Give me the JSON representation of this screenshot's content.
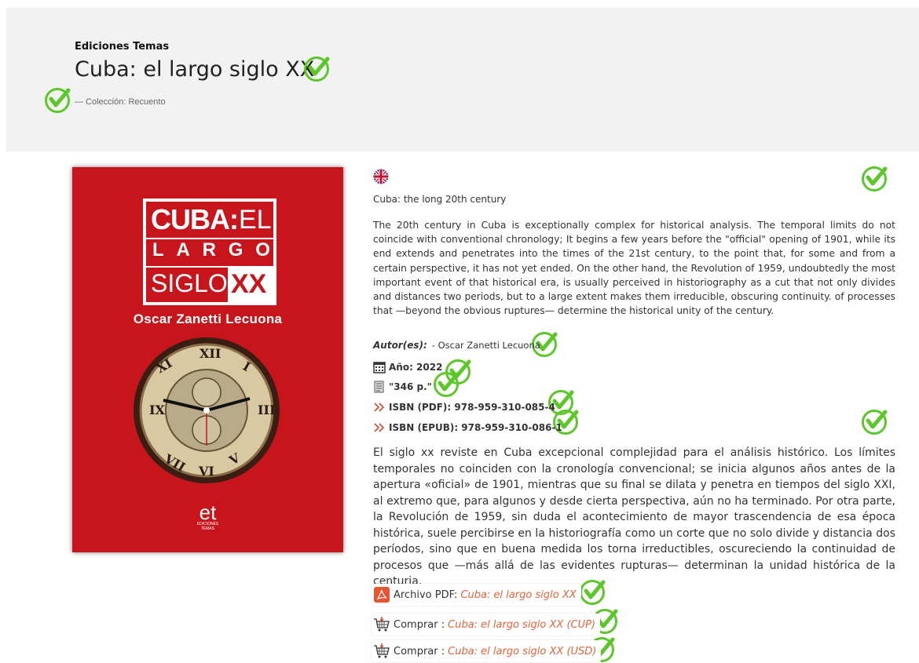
{
  "header": {
    "publisher": "Ediciones Temas",
    "title": "Cuba: el largo siglo XX",
    "collection": "— Colección: Recuento"
  },
  "cover": {
    "line1a": "CUBA:",
    "line1b": "EL",
    "line2": [
      "L",
      "A",
      "R",
      "G",
      "O"
    ],
    "line3a": "SIGLO",
    "line3b": "XX",
    "author": "Oscar Zanetti Lecuona",
    "logo": "et",
    "logo_sub1": "EDICIONES",
    "logo_sub2": "TEMAS",
    "bg_color": "#c8151b"
  },
  "english": {
    "title": "Cuba: the long 20th century",
    "description": "The 20th century in Cuba is exceptionally complex for historical analysis. The temporal limits do not coincide with conventional chronology; It begins a few years before the \"official\" opening of 1901, while its end extends and penetrates into the times of the 21st century, to the point that, for some and from a certain perspective, it has not yet ended. On the other hand, the Revolution of 1959, undoubtedly the most important event of that historical era, is usually perceived in historiography as a cut that not only divides and distances two periods, but to a large extent makes them irreducible, obscuring continuity. of processes that —beyond the obvious ruptures— determine the historical unity of the century."
  },
  "meta": {
    "author_label": "Autor(es):",
    "author_value": "- Oscar Zanetti Lecuona",
    "year": "Año: 2022",
    "pages": "\"346 p.\"",
    "isbn_pdf": "ISBN (PDF): 978-959-310-085-4",
    "isbn_epub": "ISBN (EPUB): 978-959-310-086-1"
  },
  "spanish_description": "El siglo xx reviste en Cuba excepcional complejidad para el análisis histórico. Los límites temporales no coinciden con la cronología convencional; se inicia algunos años antes de la apertura «oficial» de 1901, mientras que su final se dilata y penetra en tiempos del siglo XXI, al extremo que, para algunos y desde cierta perspectiva, aún no ha terminado. Por otra parte, la Revolución de 1959, sin duda el acontecimiento de mayor trascendencia de esa época histórica, suele percibirse en la historiografía como un corte que no solo divide y distancia dos períodos, sino que en buena medida los torna irreductibles, oscureciendo la continuidad de procesos que —más allá de las evidentes rupturas— determinan la unidad histórica de la centuria.",
  "downloads": {
    "pdf_label": "Archivo PDF:",
    "pdf_link": "Cuba: el largo siglo XX",
    "buy_cup_label": "Comprar :",
    "buy_cup_link": "Cuba: el largo siglo XX (CUP)",
    "buy_usd_label": "Comprar :",
    "buy_usd_link": "Cuba: el largo siglo XX (USD)"
  },
  "colors": {
    "check": "#5cc729",
    "link": "#e8623a",
    "header_bg": "#f2f2f2"
  },
  "icons": [
    "check-icon",
    "uk-flag-icon",
    "calendar-icon",
    "pages-icon",
    "chevron-double-right-icon",
    "pdf-icon",
    "cart-icon"
  ]
}
